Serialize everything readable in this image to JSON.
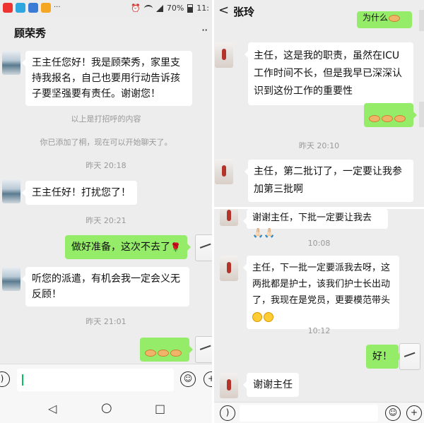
{
  "left": {
    "status": {
      "alarm": "⏰",
      "battery": "70%",
      "time": "11:"
    },
    "header": {
      "title": "顾荣秀",
      "more": "··"
    },
    "messages": {
      "m1": "王主任您好！我是顾荣秀，家里支持我报名，自己也要用行动告诉孩子要坚强要有责任。谢谢您！",
      "sys1": "以上是打招呼的内容",
      "sys2": "你已添加了桐，现在可以开始聊天了。",
      "t1": "昨天 20:18",
      "m2": "王主任好！打扰您了！",
      "t2": "昨天 20:21",
      "m3": "做好准备，这次不去了",
      "m3_emoji": "🌹",
      "m4": "听您的派遣，有机会我一定会义无反顾！",
      "t3": "昨天 21:01"
    },
    "nav": {
      "back": "◁",
      "home": "○",
      "recent": "□"
    }
  },
  "right_top": {
    "header": {
      "back": "<",
      "title": "张玲"
    },
    "messages": {
      "m0": "为什么",
      "m1": "主任，这是我的职责，虽然在ICU工作时间不长，但是我早已深深认识到这份工作的重要性",
      "t1": "昨天 20:10",
      "m2": "主任，第二批订了，一定要让我参加第三批啊"
    }
  },
  "right_bottom": {
    "messages": {
      "m1": "谢谢主任，下批一定要让我去🙏🏻🙏🏻",
      "t1": "10:08",
      "m2": "主任，下一批一定要派我去呀，这两批都是护士，该我们护士长出动了，我现在是党员，更要模范带头",
      "t2": "10:12",
      "m3": "好！",
      "m4": "谢谢主任"
    }
  },
  "icons": {
    "voice": "voice-icon",
    "emoji": "emoji-icon",
    "plus": "plus-icon"
  }
}
